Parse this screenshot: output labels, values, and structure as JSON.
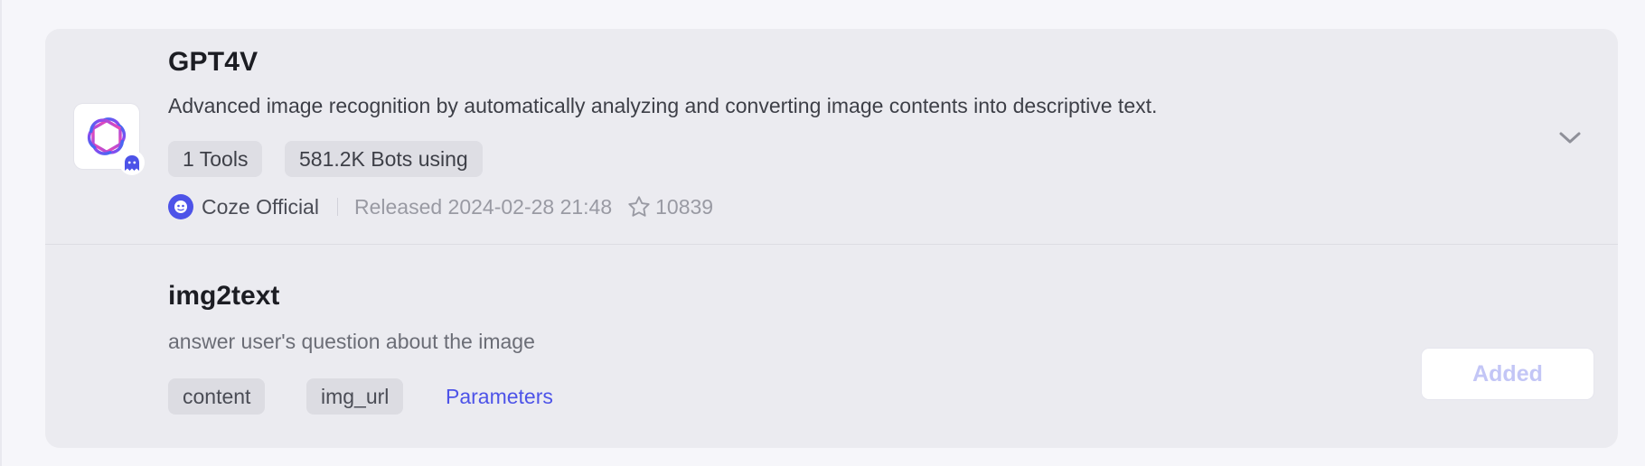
{
  "plugin": {
    "title": "GPT4V",
    "description": "Advanced image recognition by automatically analyzing and converting image contents into descriptive text.",
    "tags": {
      "tools": "1 Tools",
      "bots": "581.2K Bots using"
    },
    "author": "Coze Official",
    "released": "Released 2024-02-28 21:48",
    "favorites": "10839",
    "icon": "openai-logo-icon",
    "badge_icon": "coze-official-badge-icon",
    "expand_icon": "chevron-down-icon"
  },
  "tool": {
    "name": "img2text",
    "description": "answer user's question about the image",
    "params": [
      "content",
      "img_url"
    ],
    "parameters_link": "Parameters",
    "added_label": "Added"
  },
  "colors": {
    "accent": "#4d53e8",
    "added_text": "#c3c6f6",
    "card_bg": "#ebebf0",
    "page_bg": "#f6f6fa"
  }
}
